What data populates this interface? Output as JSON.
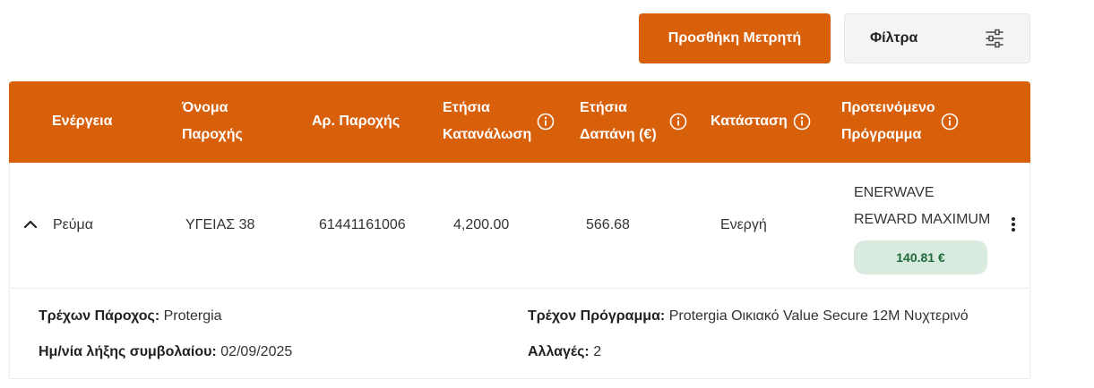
{
  "toolbar": {
    "add_meter_label": "Προσθήκη Μετρητή",
    "filters_label": "Φίλτρα"
  },
  "table": {
    "headers": {
      "energy": "Ενέργεια",
      "provider_name_l1": "Όνομα",
      "provider_name_l2": "Παροχής",
      "supply_number": "Αρ. Παροχής",
      "annual_consumption_l1": "Ετήσια",
      "annual_consumption_l2": "Κατανάλωση",
      "annual_cost_l1": "Ετήσια",
      "annual_cost_l2": "Δαπάνη (€)",
      "status": "Κατάσταση",
      "proposed_plan_l1": "Προτεινόμενο",
      "proposed_plan_l2": "Πρόγραμμα"
    },
    "row": {
      "energy": "Ρεύμα",
      "provider_name": "ΥΓΕΙΑΣ 38",
      "supply_number": "61441161006",
      "annual_consumption": "4,200.00",
      "annual_cost": "566.68",
      "status": "Ενεργή",
      "proposed_plan_l1": "ENERWAVE",
      "proposed_plan_l2": "REWARD MAXIMUM",
      "proposed_price": "140.81 €"
    },
    "details": {
      "current_provider_label": "Τρέχων Πάροχος:",
      "current_provider_value": "Protergia",
      "contract_end_label": "Ημ/νία λήξης συμβολαίου:",
      "contract_end_value": "02/09/2025",
      "current_plan_label": "Τρέχον Πρόγραμμα:",
      "current_plan_value": "Protergia Οικιακό Value Secure 12M Νυχτερινό",
      "changes_label": "Αλλαγές:",
      "changes_value": "2"
    }
  },
  "colors": {
    "accent": "#d9600a",
    "pill_bg": "#d9ebdf",
    "pill_text": "#1e6b3a"
  }
}
